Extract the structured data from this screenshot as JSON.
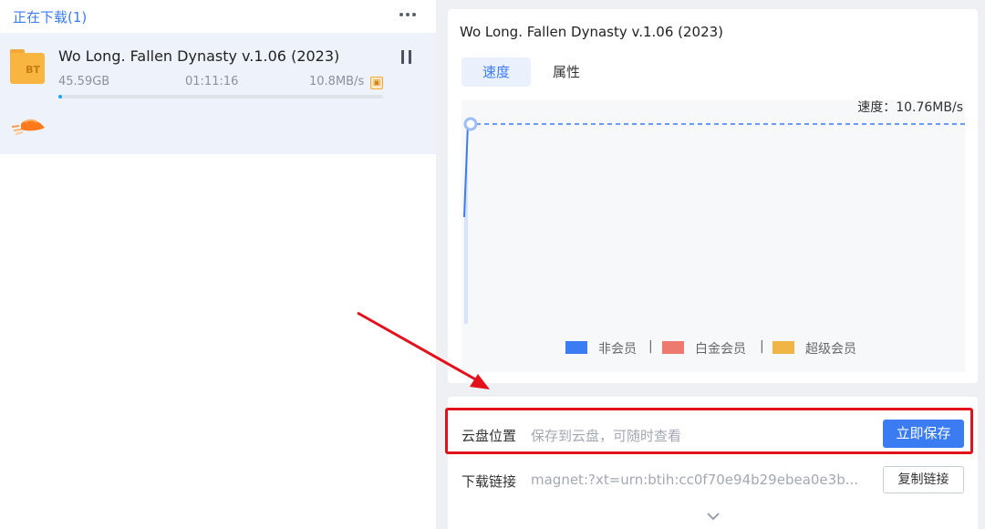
{
  "list": {
    "title": "正在下载(1)",
    "more_icon": "more-horizontal-icon",
    "task": {
      "icon_label": "BT",
      "name": "Wo Long. Fallen Dynasty v.1.06 (2023)",
      "size": "45.59GB",
      "time": "01:11:16",
      "speed": "10.8MB/s",
      "progress_fraction": 0.012,
      "pause_icon": "pause-icon",
      "speed_boost_icon": "rocket-speed-icon"
    }
  },
  "detail": {
    "title": "Wo Long. Fallen Dynasty v.1.06 (2023)",
    "tabs": [
      {
        "label": "速度",
        "active": true
      },
      {
        "label": "属性",
        "active": false
      }
    ],
    "speed_readout": "速度：10.76MB/s",
    "legend": [
      {
        "label": "非会员",
        "color": "#3b7cf3"
      },
      {
        "label": "白金会员",
        "color": "#ee7a6f"
      },
      {
        "label": "超级会员",
        "color": "#f1b546"
      }
    ]
  },
  "chart_data": {
    "type": "area",
    "series": [
      {
        "values": [
          9.6,
          10.76
        ]
      }
    ],
    "current_value": 10.76,
    "grid": false,
    "legend_position": "bottom-center"
  },
  "save": {
    "cloud_label": "云盘位置",
    "cloud_placeholder": "保存到云盘，可随时查看",
    "save_button": "立即保存",
    "link_label": "下载链接",
    "link_value": "magnet:?xt=urn:btih:cc0f70e94b29ebea0e3b...",
    "copy_button": "复制链接",
    "expand_icon": "chevron-down-icon"
  },
  "colors": {
    "accent": "#3b7cf3",
    "highlight_border": "#e3111b",
    "progress": "#1fa3ff"
  }
}
